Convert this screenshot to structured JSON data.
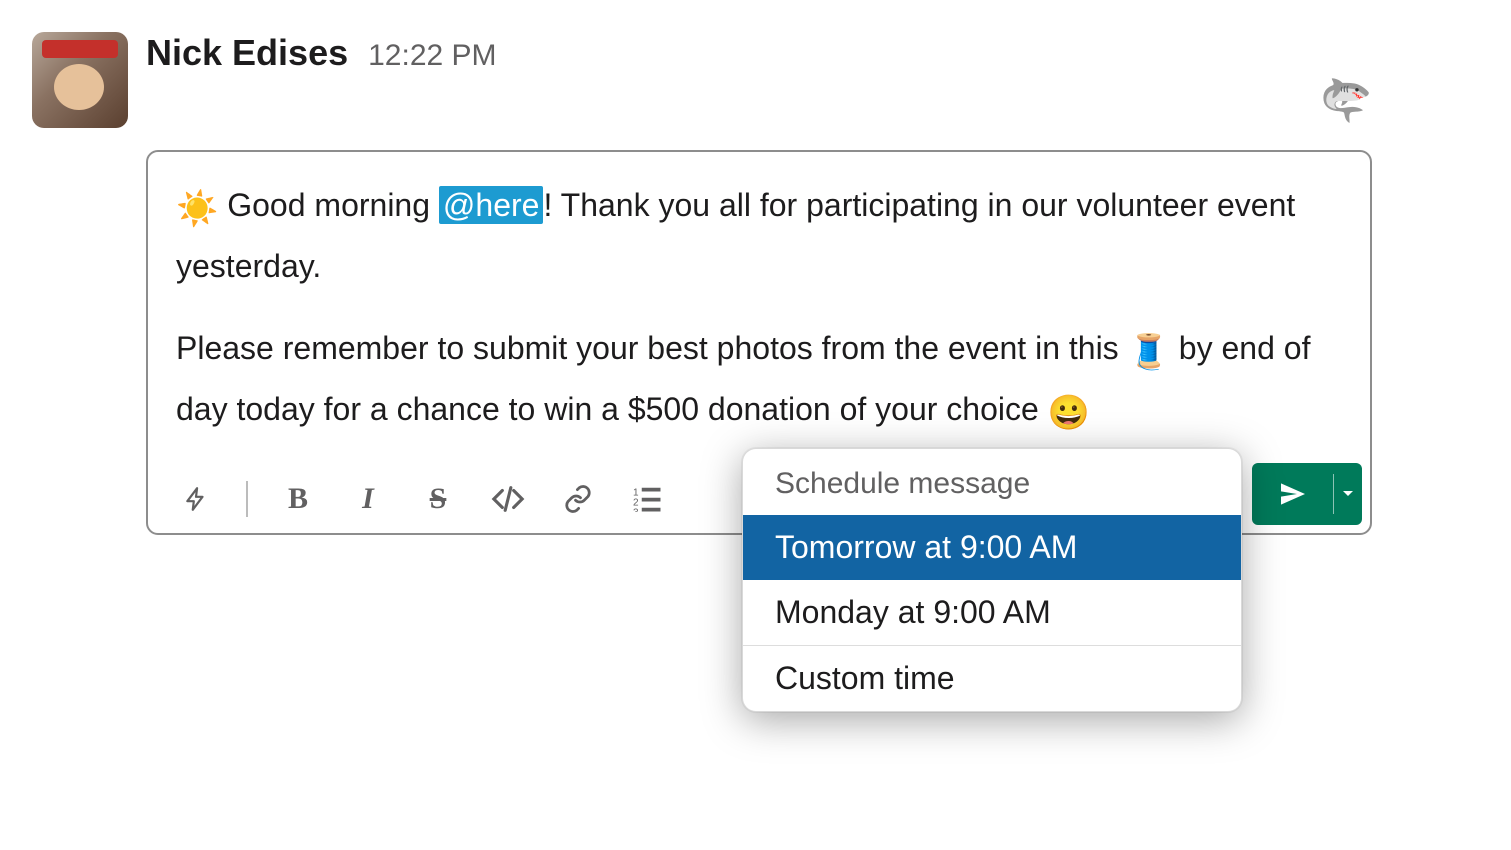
{
  "message": {
    "username": "Nick Edises",
    "timestamp": "12:22 PM",
    "status_emoji": "🦈"
  },
  "composer": {
    "text": {
      "line1_prefix_emoji": "☀️",
      "line1_part1": " Good morning ",
      "mention": "@here",
      "line1_part2": "! Thank you all for participating in our volunteer event yesterday.",
      "line2_part1": "Please remember to submit your best photos from the event in this ",
      "thread_emoji": "🧵",
      "line2_part2": " by end of day today for a chance to win a $500 donation of your choice ",
      "smile_emoji": "😀"
    },
    "toolbar": {
      "shortcuts": "⚡",
      "bold": "B",
      "italic": "I",
      "strike": "S",
      "code": "</>",
      "link": "🔗",
      "ordered_list": "≡"
    }
  },
  "schedule_menu": {
    "header": "Schedule message",
    "option_1": "Tomorrow at 9:00 AM",
    "option_2": "Monday at 9:00 AM",
    "option_custom": "Custom time"
  }
}
